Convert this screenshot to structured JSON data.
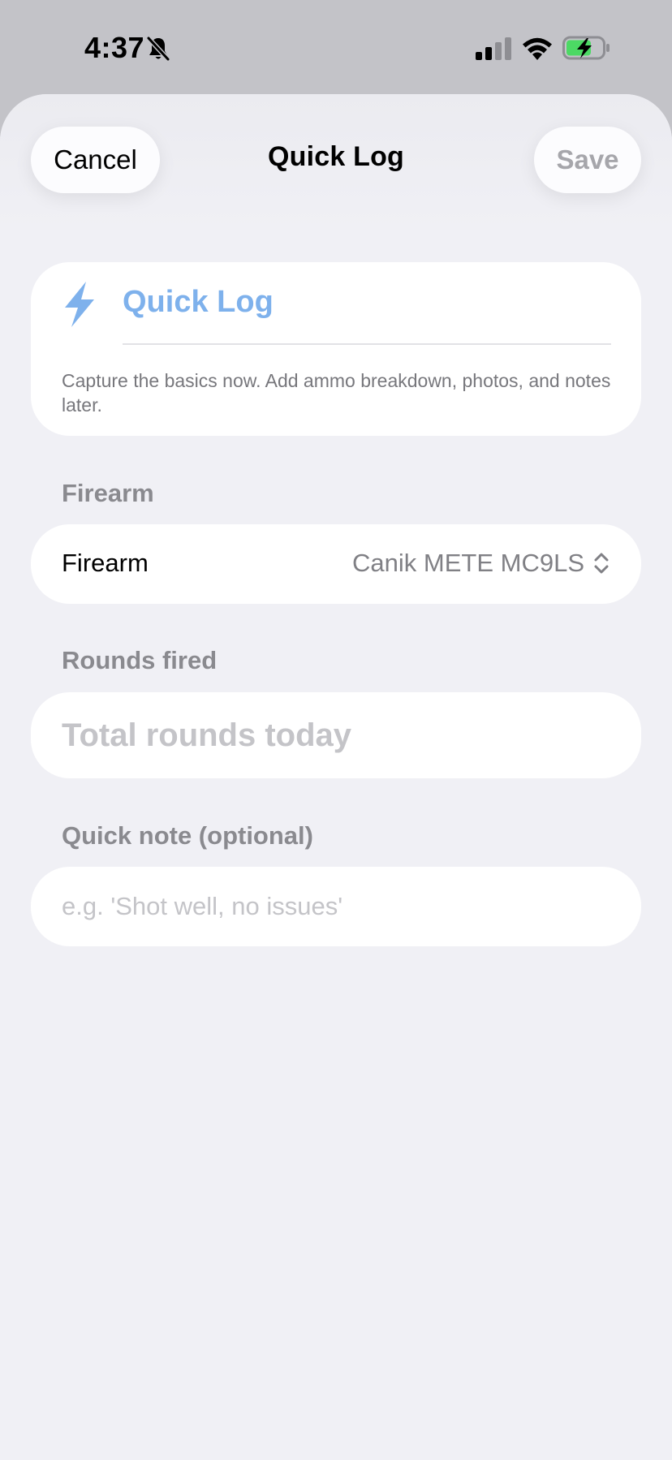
{
  "status_bar": {
    "time": "4:37",
    "icons": [
      "bell-slash-icon",
      "cellular-signal-icon",
      "wifi-icon",
      "battery-charging-icon"
    ],
    "battery_color": "#4cd964"
  },
  "header": {
    "cancel_label": "Cancel",
    "title": "Quick Log",
    "save_label": "Save"
  },
  "quick_card": {
    "icon": "bolt-icon",
    "title": "Quick Log",
    "description": "Capture the basics now. Add ammo breakdown, photos, and notes later."
  },
  "firearm_section": {
    "header": "Firearm",
    "row_label": "Firearm",
    "selected_value": "Canik METE MC9LS"
  },
  "rounds_section": {
    "header": "Rounds fired",
    "placeholder": "Total rounds today",
    "value": ""
  },
  "note_section": {
    "header": "Quick note (optional)",
    "placeholder": "e.g. 'Shot well, no issues'",
    "value": ""
  },
  "colors": {
    "accent": "#7eb1ec",
    "sheet_background": "#f0f0f5",
    "card_background": "#ffffff",
    "secondary_text": "#8a8a8f",
    "placeholder_text": "#c4c4c8"
  }
}
